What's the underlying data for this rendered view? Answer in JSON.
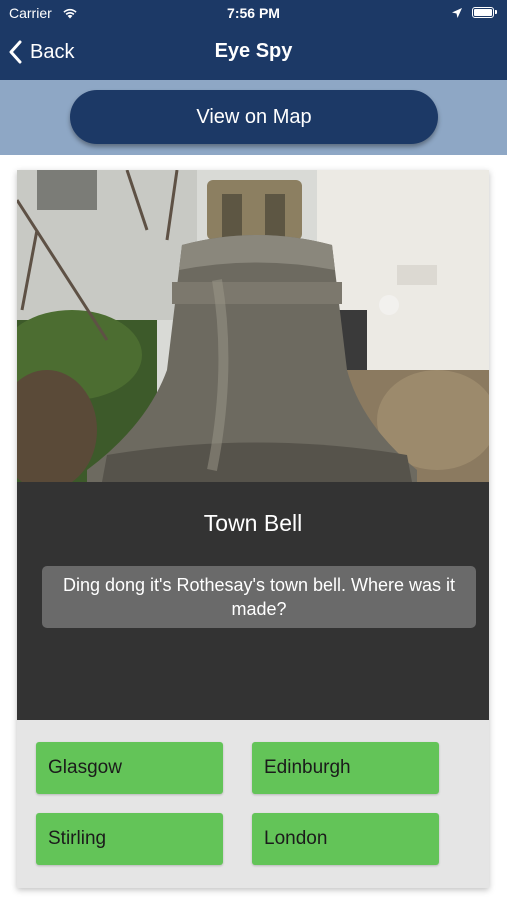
{
  "status_bar": {
    "carrier": "Carrier",
    "time": "7:56 PM"
  },
  "nav": {
    "back_label": "Back",
    "title": "Eye Spy"
  },
  "map_button": {
    "label": "View on Map"
  },
  "card": {
    "photo_icon": "bell-photo",
    "title": "Town Bell",
    "question": "Ding dong it's Rothesay's town bell. Where was it made?",
    "answers": [
      {
        "label": "Glasgow"
      },
      {
        "label": "Edinburgh"
      },
      {
        "label": "Stirling"
      },
      {
        "label": "London"
      }
    ]
  },
  "colors": {
    "nav_bar": "#1c3966",
    "map_strip": "#8ea7c5",
    "info_panel": "#333333",
    "answer_button": "#63c458"
  }
}
